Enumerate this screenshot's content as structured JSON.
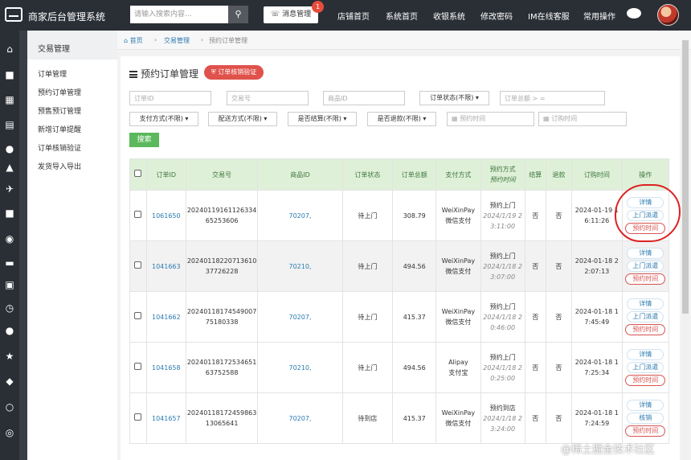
{
  "topbar": {
    "brand": "商家后台管理系统",
    "search_placeholder": "请输入搜索内容...",
    "message_label": "消息管理",
    "message_badge": "1",
    "nav": [
      "店铺首页",
      "系统首页",
      "收银系统",
      "修改密码",
      "IM在线客服",
      "常用操作"
    ]
  },
  "iconbar": [
    "home-icon",
    "truck-icon",
    "grid-icon",
    "book-icon",
    "users-icon",
    "bank-icon",
    "plane-icon",
    "gift-icon",
    "globe-icon",
    "video-icon",
    "money-icon",
    "clock-icon",
    "group-icon",
    "star-icon",
    "trophy-icon",
    "share-icon",
    "life-ring-icon"
  ],
  "sidebar": {
    "title": "交易管理",
    "items": [
      "订单管理",
      "预约订单管理",
      "预售预订管理",
      "新增订单提醒",
      "订单核销验证",
      "发货导入导出"
    ]
  },
  "breadcrumb": {
    "home": "首页",
    "sep1": "›",
    "section": "交易管理",
    "sep2": "›",
    "current": "预约订单管理"
  },
  "page": {
    "title": "预约订单管理",
    "verify_button": "订单核销验证"
  },
  "filters": {
    "order_id": "订单ID",
    "trade_no": "交易号",
    "product_id": "商品ID",
    "order_status": "订单状态(不限)",
    "order_total": "订单总额 > =",
    "pay_method": "支付方式(不限)",
    "delivery": "配送方式(不限)",
    "settled": "是否结算(不限)",
    "refund": "是否退款(不限)",
    "reserve_time": "预约时间",
    "order_time": "订购时间",
    "search_button": "搜索"
  },
  "table": {
    "headers": {
      "id": "订单ID",
      "trade": "交易号",
      "product": "商品ID",
      "status": "订单状态",
      "total": "订单总额",
      "pay": "支付方式",
      "reserve_a": "预约方式",
      "reserve_b": "预约时间",
      "settle": "结算",
      "refund": "退款",
      "time": "订购时间",
      "ops": "操作"
    },
    "rows": [
      {
        "id": "1061650",
        "trade_a": "20240119161126334",
        "trade_b": "65253606",
        "product": "70207,",
        "status": "待上门",
        "total": "308.79",
        "pay_a": "WeiXinPay",
        "pay_b": "微信支付",
        "res_a": "预约上门",
        "res_b": "2024/1/19 2",
        "res_c": "3:11:00",
        "settle": "否",
        "refund": "否",
        "time_a": "2024-01-19 1",
        "time_b": "6:11:26",
        "ops": [
          "详情",
          "上门派遣",
          "预约时间"
        ]
      },
      {
        "id": "1041663",
        "trade_a": "20240118220713610",
        "trade_b": "37726228",
        "product": "70210,",
        "status": "待上门",
        "total": "494.56",
        "pay_a": "WeiXinPay",
        "pay_b": "微信支付",
        "res_a": "预约上门",
        "res_b": "2024/1/18 2",
        "res_c": "3:07:00",
        "settle": "否",
        "refund": "否",
        "time_a": "2024-01-18 2",
        "time_b": "2:07:13",
        "ops": [
          "详情",
          "上门派遣",
          "预约时间"
        ]
      },
      {
        "id": "1041662",
        "trade_a": "20240118174549007",
        "trade_b": "75180338",
        "product": "70207,",
        "status": "待上门",
        "total": "415.37",
        "pay_a": "WeiXinPay",
        "pay_b": "微信支付",
        "res_a": "预约上门",
        "res_b": "2024/1/18 2",
        "res_c": "0:46:00",
        "settle": "否",
        "refund": "否",
        "time_a": "2024-01-18 1",
        "time_b": "7:45:49",
        "ops": [
          "详情",
          "上门派遣",
          "预约时间"
        ]
      },
      {
        "id": "1041658",
        "trade_a": "20240118172534651",
        "trade_b": "63752588",
        "product": "70210,",
        "status": "待上门",
        "total": "494.56",
        "pay_a": "Alipay",
        "pay_b": "支付宝",
        "res_a": "预约上门",
        "res_b": "2024/1/18 2",
        "res_c": "0:25:00",
        "settle": "否",
        "refund": "否",
        "time_a": "2024-01-18 1",
        "time_b": "7:25:34",
        "ops": [
          "详情",
          "上门派遣",
          "预约时间"
        ]
      },
      {
        "id": "1041657",
        "trade_a": "20240118172459863",
        "trade_b": "13065641",
        "product": "70207,",
        "status": "待到店",
        "total": "415.37",
        "pay_a": "WeiXinPay",
        "pay_b": "微信支付",
        "res_a": "预约到店",
        "res_b": "2024/1/18 2",
        "res_c": "3:24:00",
        "settle": "否",
        "refund": "否",
        "time_a": "2024-01-18 1",
        "time_b": "7:24:59",
        "ops": [
          "详情",
          "核销",
          "预约时间"
        ]
      }
    ]
  },
  "watermark": "@稀土掘金技术社区"
}
